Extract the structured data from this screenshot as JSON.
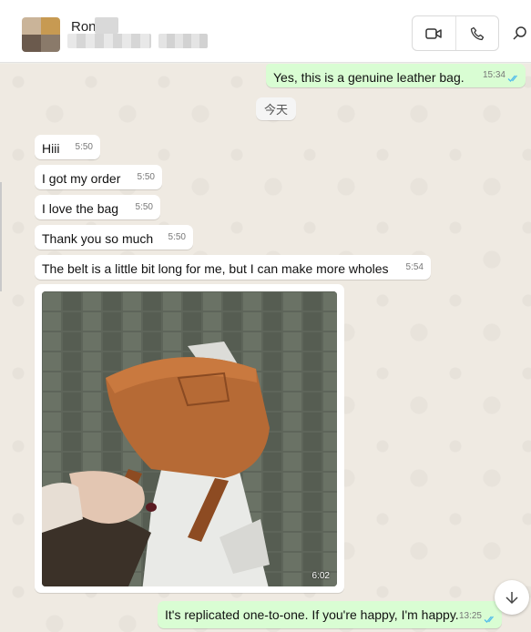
{
  "header": {
    "contact_name": "Ron",
    "icons": [
      "video-camera-icon",
      "phone-icon",
      "search-icon"
    ]
  },
  "chat": {
    "date_divider": "今天",
    "messages": [
      {
        "direction": "out",
        "text": "Yes, this is a genuine leather bag.",
        "time": "15:34",
        "read": true
      },
      {
        "direction": "in",
        "text": "Hiii",
        "time": "5:50"
      },
      {
        "direction": "in",
        "text": "I got my order",
        "time": "5:50"
      },
      {
        "direction": "in",
        "text": "I love the bag",
        "time": "5:50"
      },
      {
        "direction": "in",
        "text": "Thank you so much",
        "time": "5:50"
      },
      {
        "direction": "in",
        "text": "The belt is a little bit long for me, but I can make more wholes",
        "time": "5:54"
      },
      {
        "direction": "in",
        "type": "image",
        "image_alt": "brown leather bag",
        "time": "6:02"
      },
      {
        "direction": "out",
        "text": "It's replicated one-to-one. If you're happy, I'm happy.",
        "time": "13:25",
        "read": true
      }
    ]
  },
  "colors": {
    "chat_background": "#efeae2",
    "outgoing_bubble": "#d9fdd3",
    "incoming_bubble": "#ffffff",
    "read_ticks": "#53bdeb"
  }
}
